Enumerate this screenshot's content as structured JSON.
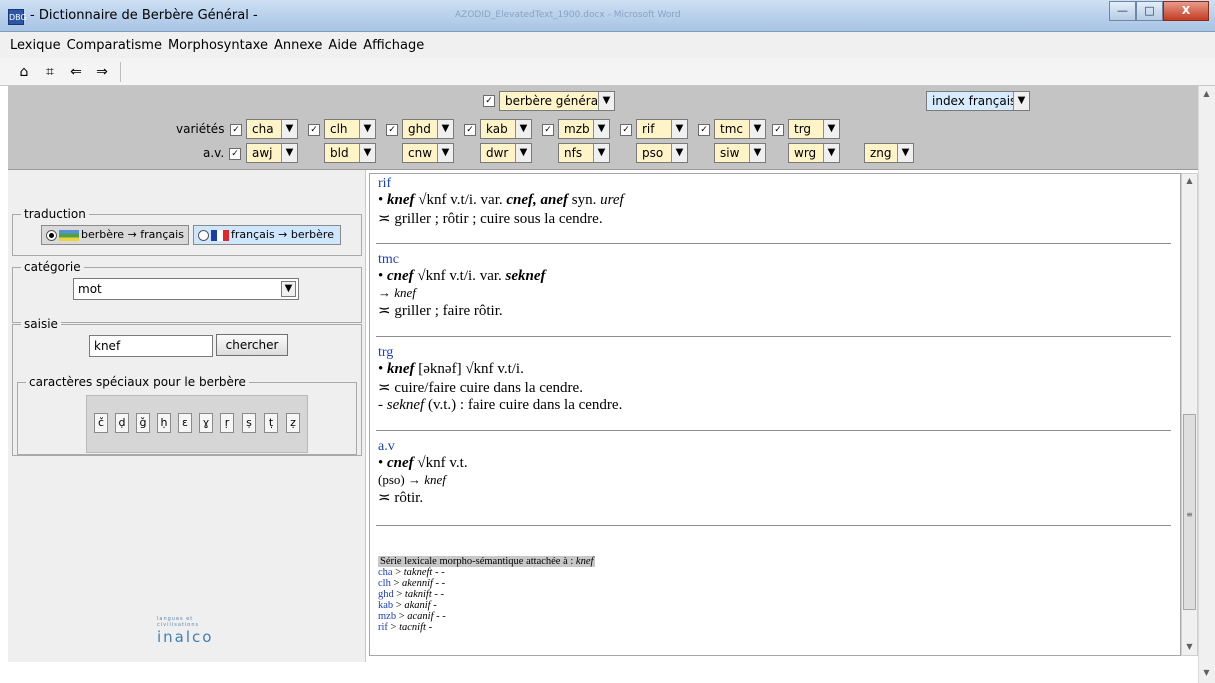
{
  "window": {
    "icon_text": "DBG",
    "title": "- Dictionnaire de Berbère Général -",
    "background_title": "AZODID_ElevatedText_1900.docx - Microsoft Word",
    "minimize": "—",
    "maximize": "□",
    "close": "X"
  },
  "menu": [
    "Lexique",
    "Comparatisme",
    "Morphosyntaxe",
    "Annexe",
    "Aide",
    "Affichage"
  ],
  "toolbar": {
    "home": "⌂",
    "grid": "⌗",
    "back": "⇐",
    "forward": "⇒"
  },
  "varieties_panel": {
    "main_check": "✓",
    "main_variety": "berbère général",
    "index": "index français",
    "varietes_label": "variétés",
    "av_label": "a.v.",
    "av_check": "✓",
    "varieties": [
      {
        "code": "cha",
        "checked": "✓"
      },
      {
        "code": "clh",
        "checked": "✓"
      },
      {
        "code": "ghd",
        "checked": "✓"
      },
      {
        "code": "kab",
        "checked": "✓"
      },
      {
        "code": "mzb",
        "checked": "✓"
      },
      {
        "code": "rif",
        "checked": "✓"
      },
      {
        "code": "tmc",
        "checked": "✓"
      },
      {
        "code": "trg",
        "checked": "✓"
      }
    ],
    "av_varieties": [
      "awj",
      "bld",
      "cnw",
      "dwr",
      "nfs",
      "pso",
      "siw",
      "wrg",
      "zng"
    ]
  },
  "left_panel": {
    "traduction_title": "traduction",
    "berber_to_french": "berbère → français",
    "french_to_berber": "français → berbère",
    "categorie_title": "catégorie",
    "categorie_value": "mot",
    "saisie_title": "saisie",
    "saisie_value": "knef",
    "search_button": "chercher",
    "chars_title": "caractères spéciaux pour le berbère",
    "special_chars": [
      "č",
      "ḍ",
      "ǧ",
      "ḥ",
      "ɛ",
      "ɣ",
      "ṛ",
      "ṣ",
      "ṭ",
      "ẓ"
    ],
    "logo_tagline": "langues et civilisations",
    "logo_text": "inalco"
  },
  "results": {
    "rif": {
      "label": "rif",
      "headword": "knef",
      "root": "√knf",
      "pos": "v.t/i.",
      "var_label": "var.",
      "variants": "cnef, anef",
      "syn_label": "syn.",
      "syn": "uref",
      "gloss_mark": "≍",
      "gloss": "griller ; rôtir ; cuire sous la cendre."
    },
    "tmc": {
      "label": "tmc",
      "headword": "cnef",
      "root": "√knf",
      "pos": "v.t/i.",
      "var_label": "var.",
      "variant": "seknef",
      "ref_arrow": "→",
      "ref": "knef",
      "gloss_mark": "≍",
      "gloss": "griller ; faire rôtir."
    },
    "trg": {
      "label": "trg",
      "headword": "knef",
      "pron": "[əknəf]",
      "root": "√knf",
      "pos": "v.t/i.",
      "gloss_mark": "≍",
      "gloss": "cuire/faire cuire dans la cendre.",
      "deriv_dash": "-",
      "deriv": "seknef",
      "deriv_pos": "(v.t.)",
      "deriv_gloss": ": faire cuire dans la cendre."
    },
    "av": {
      "label": "a.v",
      "headword": "cnef",
      "root": "√knf",
      "pos": "v.t.",
      "source": "(pso)",
      "ref_arrow": "→",
      "ref": "knef",
      "gloss_mark": "≍",
      "gloss": "rôtir."
    },
    "serie": {
      "title": "Série lexicale morpho-sémantique attachée à :",
      "title_word": "knef",
      "items": [
        {
          "variety": "cha",
          "word": "takneft",
          "tail": "- -"
        },
        {
          "variety": "clh",
          "word": "akennif",
          "tail": "- -"
        },
        {
          "variety": "ghd",
          "word": "taknift",
          "tail": "- -"
        },
        {
          "variety": "kab",
          "word": "akanif",
          "tail": "-"
        },
        {
          "variety": "mzb",
          "word": "acanif",
          "tail": "- -"
        },
        {
          "variety": "rif",
          "word": "tacnift",
          "tail": "-"
        }
      ]
    }
  },
  "scrollbars": {
    "up": "▲",
    "down": "▼",
    "grip": "≡"
  }
}
